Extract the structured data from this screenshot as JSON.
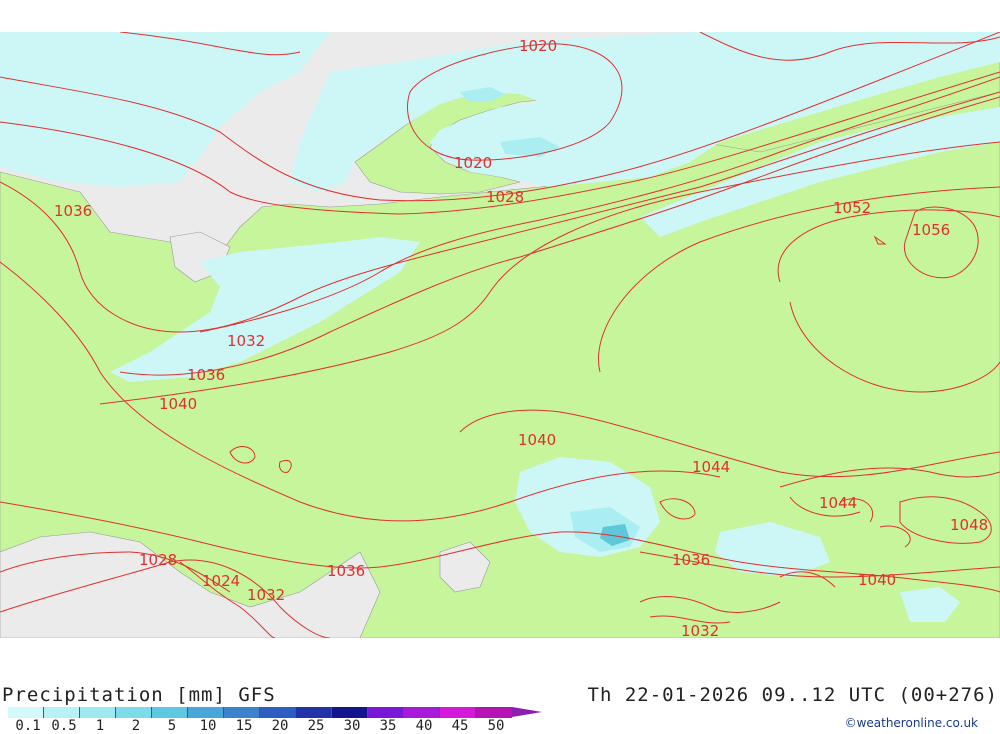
{
  "title": {
    "left": "Precipitation [mm] GFS",
    "right": "Th 22-01-2026 09..12 UTC (00+276)"
  },
  "credit": "©weatheronline.co.uk",
  "colors": {
    "sea": "#ebebeb",
    "land": "#c6f59c",
    "precip_light": "#cdf7f7",
    "precip_mid": "#aaeef2",
    "precip_heavy": "#5ec8d8",
    "isobar": "#e03030",
    "border": "#999999"
  },
  "legend": {
    "ticks": [
      "0.1",
      "0.5",
      "1",
      "2",
      "5",
      "10",
      "15",
      "20",
      "25",
      "30",
      "35",
      "40",
      "45",
      "50"
    ],
    "colors": [
      "#d4f9fb",
      "#b8f2f6",
      "#9ee9f1",
      "#7edbea",
      "#5ec8e0",
      "#4aa6d8",
      "#3b84cc",
      "#2e5fc0",
      "#2232a8",
      "#14148c",
      "#7a18d8",
      "#a61ad8",
      "#d41ad8",
      "#b414b4"
    ]
  },
  "isobar_labels": [
    {
      "text": "1020"
    },
    {
      "text": "1020"
    },
    {
      "text": "1028"
    },
    {
      "text": "1036"
    },
    {
      "text": "1052"
    },
    {
      "text": "1056"
    },
    {
      "text": "1032"
    },
    {
      "text": "1036"
    },
    {
      "text": "1040"
    },
    {
      "text": "1040"
    },
    {
      "text": "1044"
    },
    {
      "text": "1044"
    },
    {
      "text": "1048"
    },
    {
      "text": "1028"
    },
    {
      "text": "1024"
    },
    {
      "text": "1032"
    },
    {
      "text": "1036"
    },
    {
      "text": "1036"
    },
    {
      "text": "1040"
    },
    {
      "text": "1032"
    }
  ]
}
